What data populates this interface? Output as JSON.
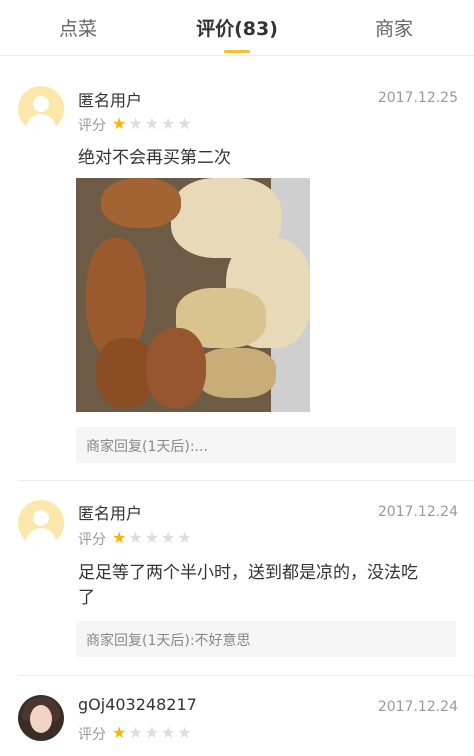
{
  "tabs": [
    {
      "label": "点菜"
    },
    {
      "label": "评价(83)"
    },
    {
      "label": "商家"
    }
  ],
  "reviews": [
    {
      "user": "匿名用户",
      "date": "2017.12.25",
      "rating_label": "评分",
      "rating": 1,
      "text": "绝对不会再买第二次",
      "reply": "商家回复(1天后):..."
    },
    {
      "user": "匿名用户",
      "date": "2017.12.24",
      "rating_label": "评分",
      "rating": 1,
      "text_line1": "足足等了两个半小时，送到都是凉的，没法吃",
      "text_line2": "了",
      "reply": "商家回复(1天后):不好意思"
    },
    {
      "user": "gOj403248217",
      "date": "2017.12.24",
      "rating_label": "评分",
      "rating": 1
    }
  ],
  "colors": {
    "accent": "#f7c02a",
    "star_on": "#f7b500",
    "star_off": "#dddddd"
  }
}
